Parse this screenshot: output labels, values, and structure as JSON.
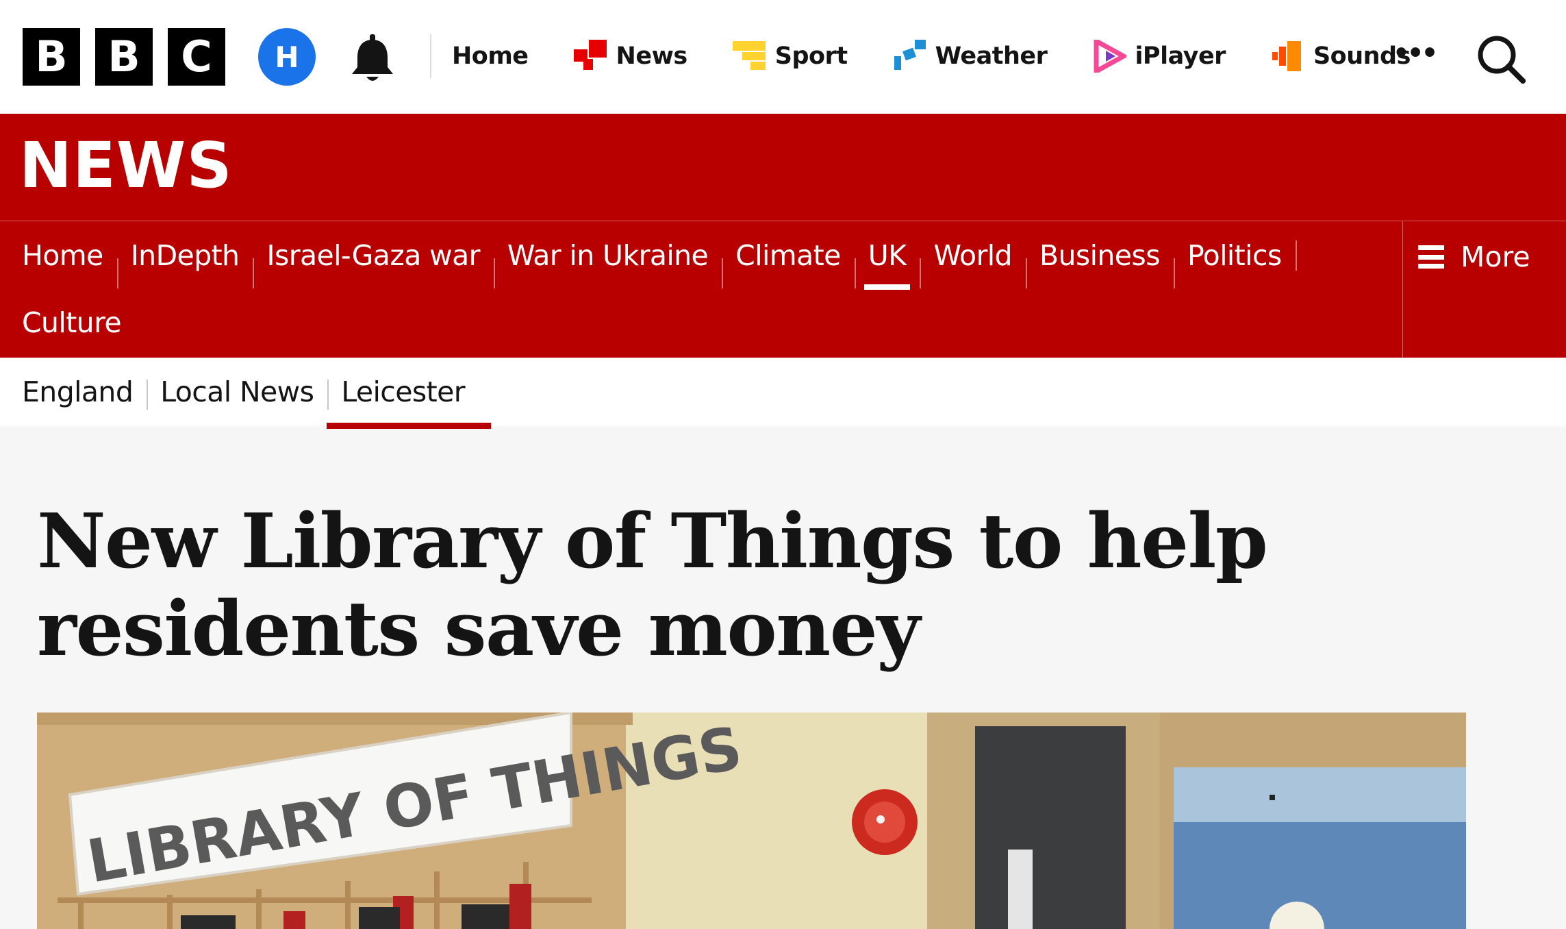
{
  "global_nav": {
    "logo_letters": [
      "B",
      "B",
      "C"
    ],
    "avatar_initial": "H",
    "items": [
      {
        "label": "Home",
        "icon": "none"
      },
      {
        "label": "News",
        "icon": "news-icon",
        "color": "#e60000"
      },
      {
        "label": "Sport",
        "icon": "sport-icon",
        "color": "#ffd230"
      },
      {
        "label": "Weather",
        "icon": "weather-icon",
        "color": "#1d8fd6"
      },
      {
        "label": "iPlayer",
        "icon": "iplayer-icon",
        "color": "#f54997"
      },
      {
        "label": "Sounds",
        "icon": "sounds-icon",
        "color": "#ff4c00"
      }
    ],
    "more_glyph": "•••"
  },
  "banner": {
    "title": "NEWS",
    "color": "#b80000"
  },
  "section_nav": {
    "row1": [
      "Home",
      "InDepth",
      "Israel-Gaza war",
      "War in Ukraine",
      "Climate",
      "UK",
      "World",
      "Business",
      "Politics"
    ],
    "row2": [
      "Culture"
    ],
    "active": "UK",
    "more_label": "More"
  },
  "sub_nav": {
    "items": [
      "England",
      "Local News",
      "Leicester"
    ],
    "active": "Leicester"
  },
  "article": {
    "headline": "New Library of Things to help residents save money",
    "image_sign_text": "LIBRARY OF THINGS"
  }
}
